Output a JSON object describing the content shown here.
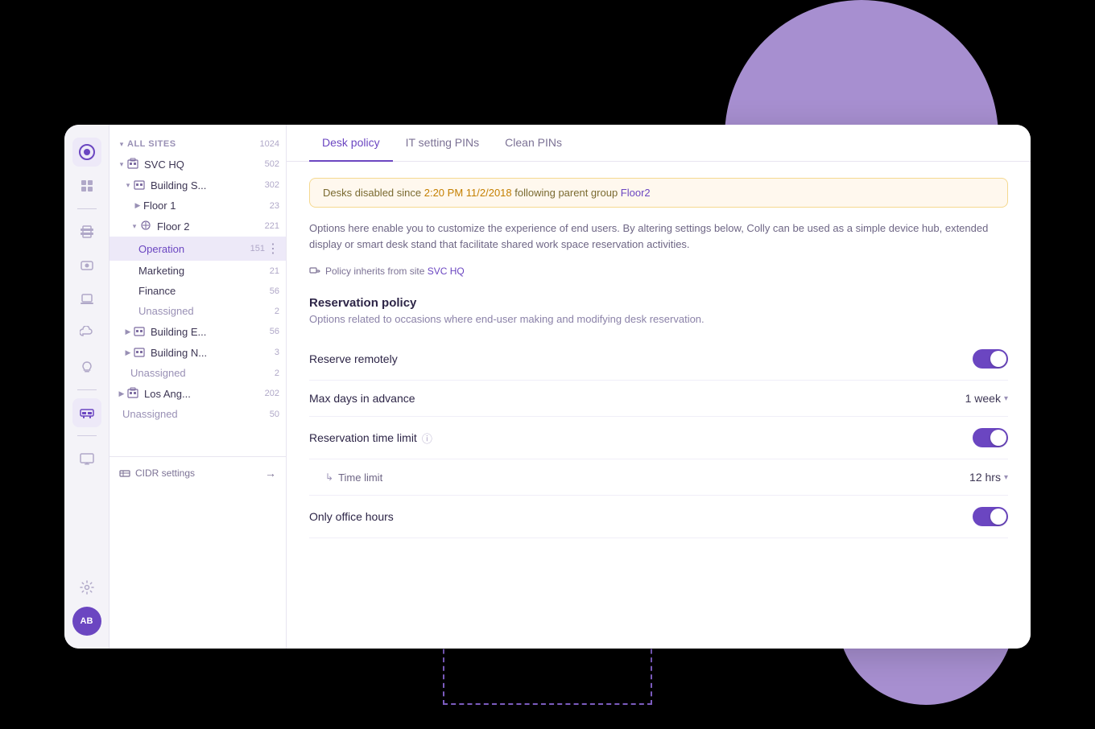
{
  "bg": {
    "circle_top": "top-right large purple circle",
    "circle_bottom": "bottom-right small purple circle"
  },
  "sidebar": {
    "cidr_label": "CIDR settings",
    "cidr_arrow": "→"
  },
  "tree": {
    "all_sites_label": "ALL SITES",
    "all_sites_count": "1024",
    "svc_hq_label": "SVC HQ",
    "svc_hq_count": "502",
    "building_s_label": "Building S...",
    "building_s_count": "302",
    "floor1_label": "Floor 1",
    "floor1_count": "23",
    "floor2_label": "Floor 2",
    "floor2_count": "221",
    "operation_label": "Operation",
    "operation_count": "151",
    "marketing_label": "Marketing",
    "marketing_count": "21",
    "finance_label": "Finance",
    "finance_count": "56",
    "unassigned1_label": "Unassigned",
    "unassigned1_count": "2",
    "building_e_label": "Building E...",
    "building_e_count": "56",
    "building_n_label": "Building N...",
    "building_n_count": "3",
    "unassigned2_label": "Unassigned",
    "unassigned2_count": "2",
    "los_ang_label": "Los Ang...",
    "los_ang_count": "202",
    "unassigned3_label": "Unassigned",
    "unassigned3_count": "50"
  },
  "tabs": [
    {
      "id": "desk-policy",
      "label": "Desk policy",
      "active": true
    },
    {
      "id": "it-setting-pins",
      "label": "IT setting PINs",
      "active": false
    },
    {
      "id": "clean-pins",
      "label": "Clean PINs",
      "active": false
    }
  ],
  "warning": {
    "text_before": "Desks disabled since 2:20 PM 11/2/2018 following parent group",
    "link_text": "Floor2"
  },
  "description": "Options here enable you to customize the experience of end users. By altering settings below, Colly can be used as a simple device hub, extended display or smart desk stand that facilitate shared work space reservation activities.",
  "policy_inherits": {
    "prefix": "Policy inherits from site",
    "link": "SVC HQ"
  },
  "reservation_policy": {
    "title": "Reservation policy",
    "description": "Options related to occasions where end-user making and modifying desk reservation.",
    "settings": [
      {
        "id": "reserve-remotely",
        "label": "Reserve remotely",
        "type": "toggle",
        "value": true,
        "indented": false
      },
      {
        "id": "max-days-advance",
        "label": "Max days in advance",
        "type": "dropdown",
        "value": "1 week",
        "indented": false
      },
      {
        "id": "reservation-time-limit",
        "label": "Reservation time limit",
        "type": "toggle",
        "value": true,
        "has_info": true,
        "indented": false
      },
      {
        "id": "time-limit",
        "label": "Time limit",
        "type": "dropdown",
        "value": "12 hrs",
        "indented": true
      },
      {
        "id": "only-office-hours",
        "label": "Only office hours",
        "type": "toggle",
        "value": true,
        "indented": false
      }
    ]
  },
  "icons": {
    "logo": "◎",
    "layers": "◫",
    "network": "⊞",
    "device": "⊡",
    "download": "⬇",
    "cloud": "☁",
    "bulb": "💡",
    "grid": "▦",
    "monitor": "▬",
    "gear": "⚙",
    "avatar": "AB",
    "building": "▦",
    "floor": "⊘",
    "policy_icon": "⊡"
  }
}
